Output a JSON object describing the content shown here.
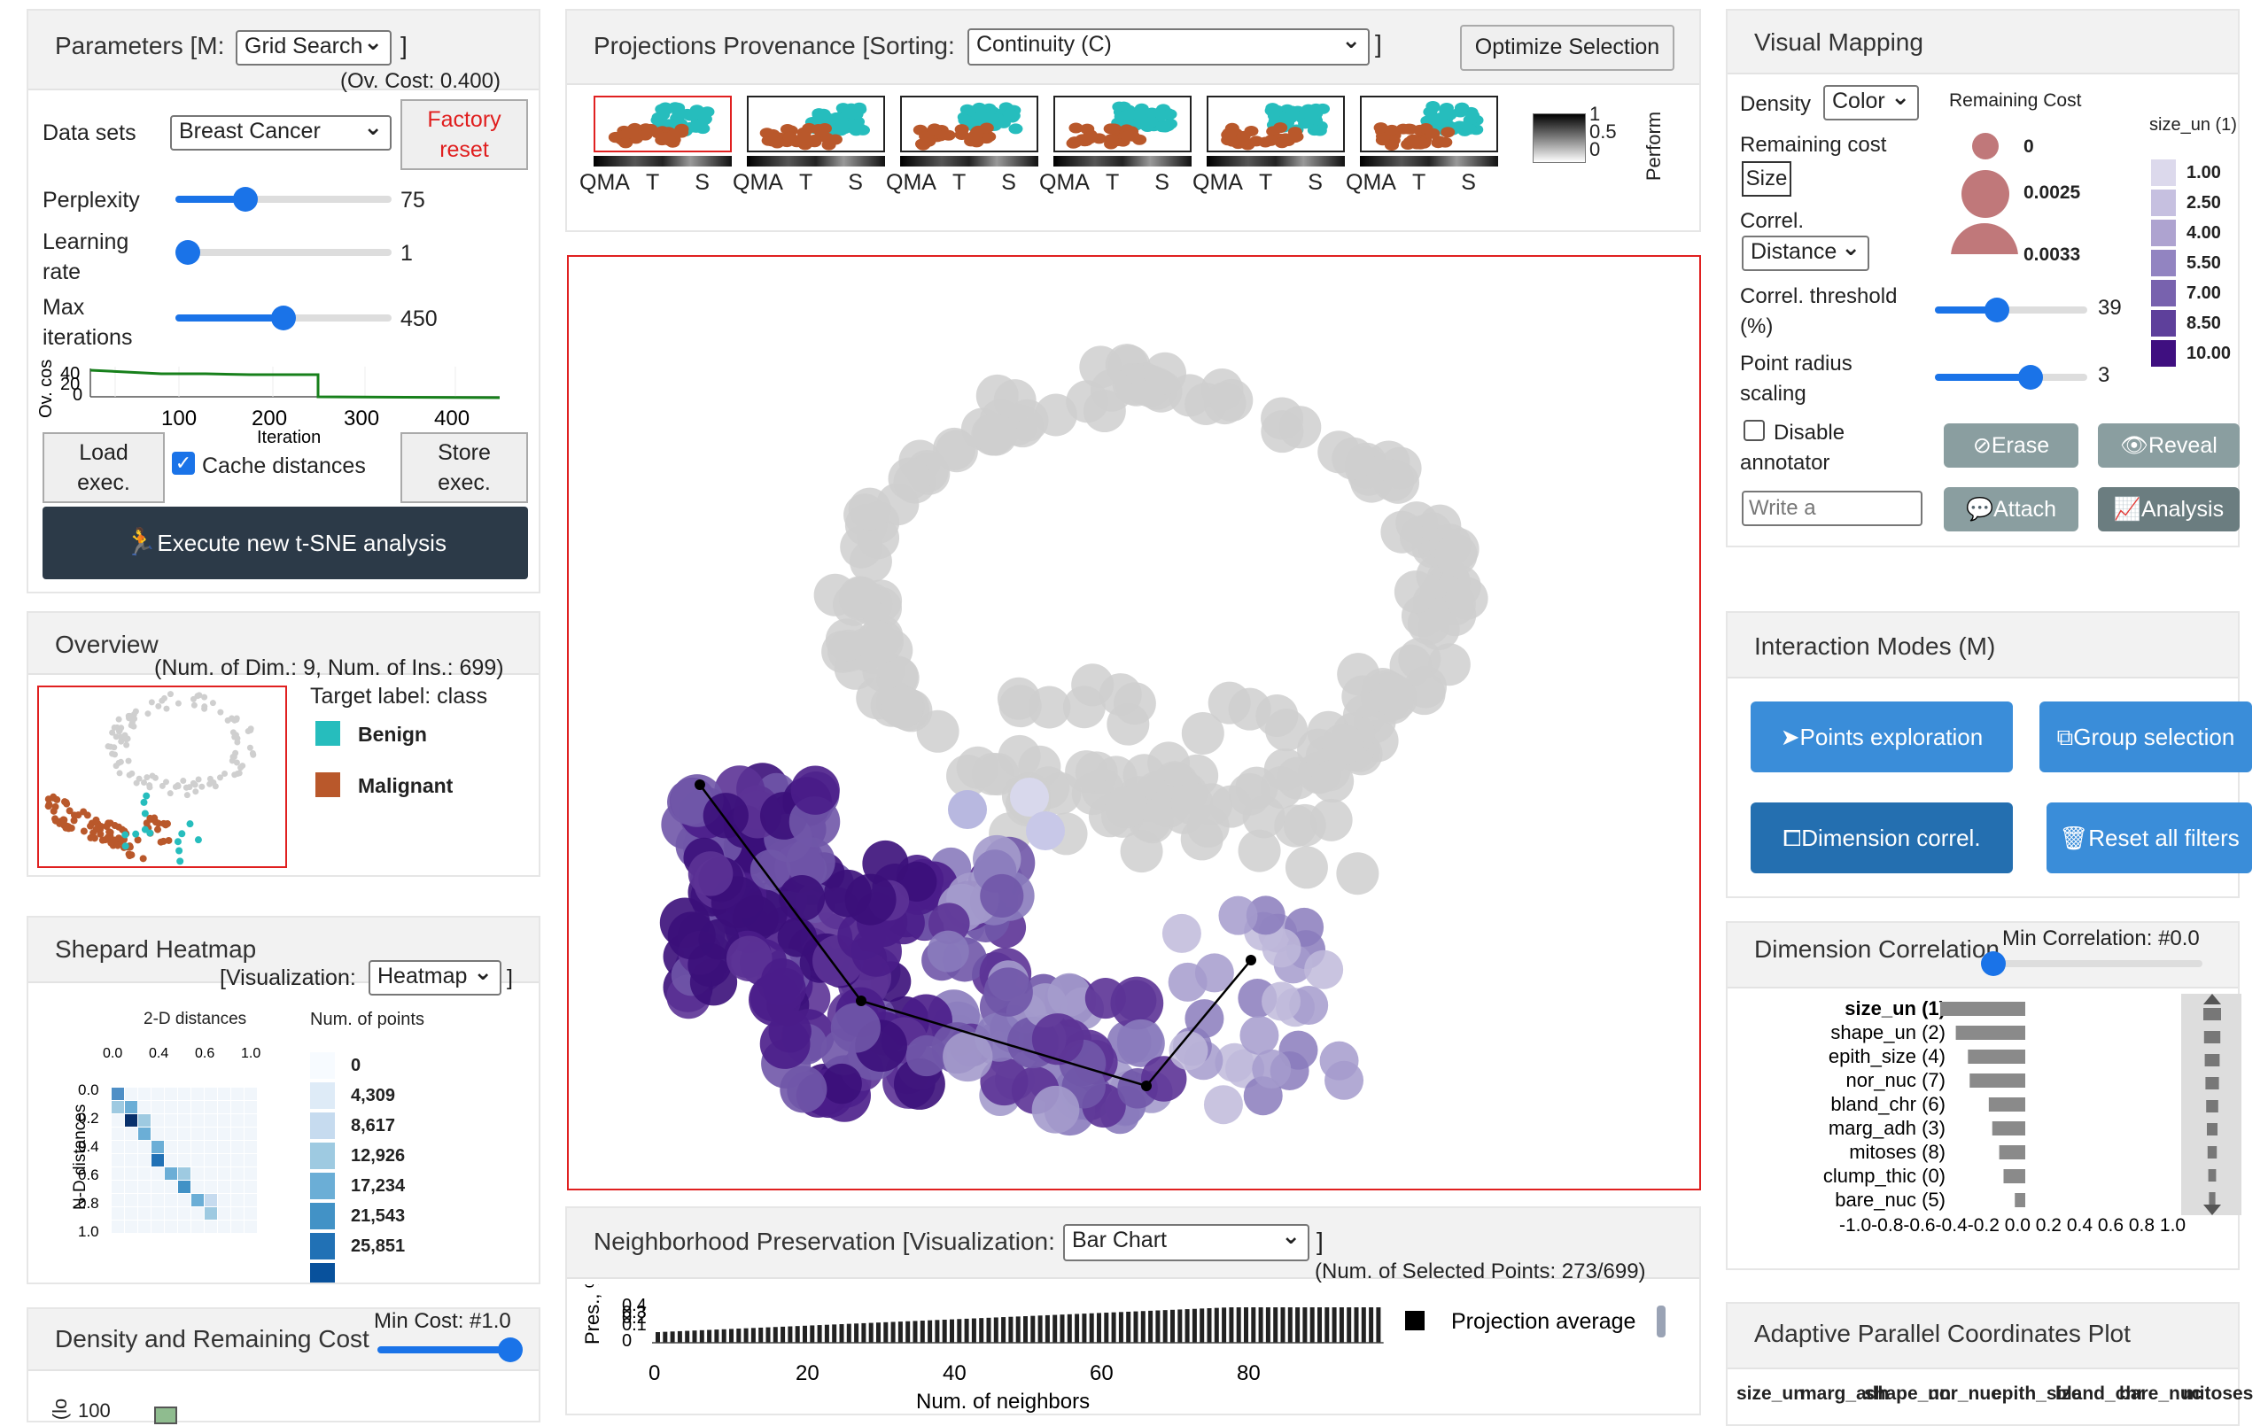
{
  "params": {
    "title": "Parameters [M:",
    "mode": "Grid Search",
    "close": "]",
    "ovcost": "(Ov. Cost: 0.400)",
    "datasets_label": "Data sets",
    "dataset": "Breast Cancer",
    "factory": "Factory reset",
    "perplexity_label": "Perplexity",
    "perplexity": "75",
    "perplexity_level": 0.3,
    "lr_label": "Learning rate",
    "lr": "1",
    "lr_level": 0.0,
    "maxit_label": "Max iterations",
    "maxit": "450",
    "maxit_level": 0.5,
    "chart_ylabel": "Ov. cos",
    "chart_yticks": [
      "40",
      "20",
      "0"
    ],
    "chart_xticks": [
      "100",
      "200",
      "300",
      "400"
    ],
    "chart_xlabel": "Iteration",
    "load": "Load exec.",
    "cache": "Cache distances",
    "store": "Store exec.",
    "execute": "Execute new t-SNE analysis"
  },
  "overview": {
    "title": "Overview",
    "info": "(Num. of Dim.: 9, Num. of Ins.: 699)",
    "target": "Target label: class",
    "benign": "Benign",
    "malignant": "Malignant",
    "benign_color": "#26bdbd",
    "malignant_color": "#b9582b"
  },
  "shepard": {
    "title": "Shepard Heatmap",
    "vis_label": "[Visualization:",
    "vis": "Heatmap",
    "close": "]",
    "xlabel": "2-D distances",
    "ylabel": "N-D distances",
    "ticks": [
      "0.0",
      "0.2",
      "0.4",
      "0.6",
      "0.8",
      "1.0"
    ],
    "xticks": [
      "0.0",
      "0.4",
      "0.6",
      "1.0"
    ],
    "legend_title": "Num. of points",
    "legend": [
      "0",
      "4,309",
      "8,617",
      "12,926",
      "17,234",
      "21,543",
      "25,851"
    ]
  },
  "density": {
    "title": "Density and Remaining Cost",
    "mincost": "Min Cost: #1.0",
    "ylabel": "(lo",
    "tick": "100"
  },
  "provenance": {
    "title": "Projections Provenance [Sorting:",
    "sorting": "Continuity (C)",
    "close": "]",
    "optimize": "Optimize Selection",
    "thumb_labels": [
      "QMA",
      "T",
      "S"
    ],
    "perf_label": "Perform",
    "perf_ticks": [
      "1",
      "0.5",
      "0"
    ]
  },
  "neighborhood": {
    "title": "Neighborhood Preservation [Visualization:",
    "vis": "Bar Chart",
    "close": "]",
    "selected": "(Num. of Selected Points: 273/699)",
    "ylabel": "Pres., %",
    "yticks": [
      "0.4",
      "0.3",
      "0.2",
      "0.1",
      "0"
    ],
    "xticks": [
      "0",
      "20",
      "40",
      "60",
      "80"
    ],
    "xlabel": "Num. of neighbors",
    "legend": "Projection average"
  },
  "visual": {
    "title": "Visual Mapping",
    "density_label": "Density",
    "density": "Color",
    "remaining_label": "Remaining cost",
    "size": "Size",
    "correl_label": "Correl.",
    "correl": "Distance",
    "threshold_label": "Correl. threshold (%)",
    "threshold": "39",
    "threshold_level": 0.39,
    "radius_label": "Point radius scaling",
    "radius": "3",
    "radius_level": 0.65,
    "disable": "Disable annotator",
    "write_placeholder": "Write a",
    "rc_title": "Remaining Cost",
    "rc_values": [
      "0",
      "0.0025",
      "0.0033"
    ],
    "size_title": "size_un (1)",
    "size_values": [
      "1.00",
      "2.50",
      "4.00",
      "5.50",
      "7.00",
      "8.50",
      "10.00"
    ],
    "erase": "Erase",
    "reveal": "Reveal",
    "attach": "Attach",
    "analysis": "Analysis"
  },
  "interaction": {
    "title": "Interaction Modes (M)",
    "points": "Points exploration",
    "group": "Group selection",
    "dimension": "Dimension correl.",
    "reset": "Reset all filters"
  },
  "dimcorr": {
    "title": "Dimension Correlation",
    "min": "Min Correlation: #0.0",
    "dims": [
      "size_un (1)",
      "shape_un (2)",
      "epith_size (4)",
      "nor_nuc (7)",
      "bland_chr (6)",
      "marg_adh (3)",
      "mitoses (8)",
      "clump_thic (0)",
      "bare_nuc (5)"
    ],
    "values": [
      -0.98,
      -0.8,
      -0.66,
      -0.64,
      -0.42,
      -0.38,
      -0.3,
      -0.25,
      -0.12
    ],
    "axis": "-1.0-0.8-0.6-0.4-0.2 0.0 0.2 0.4 0.6 0.8 1.0"
  },
  "pcp": {
    "title": "Adaptive Parallel Coordinates Plot",
    "axes": [
      "size_un",
      "marg_adh",
      "shape_un",
      "nor_nuc",
      "epith_size",
      "bland_chr",
      "bare_nuc",
      "mitoses"
    ]
  }
}
